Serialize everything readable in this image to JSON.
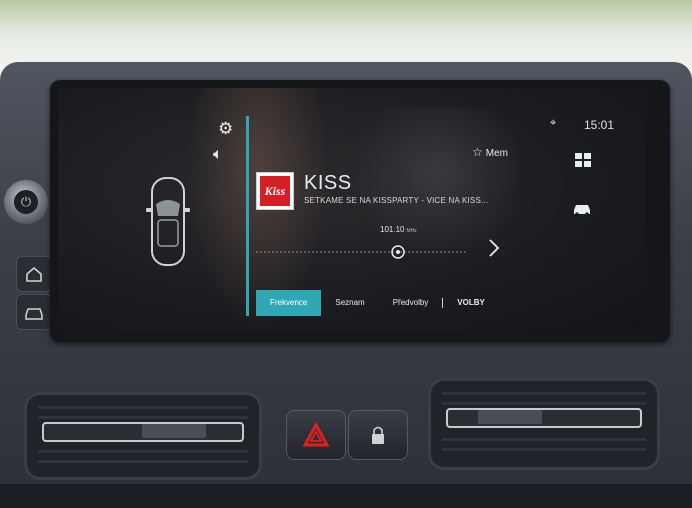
{
  "radio": {
    "station_name": "KISS",
    "logo_text": "Kiss",
    "rds_text": "SETKAME SE NA KISSPARTY - VICE NA KISS...",
    "frequency": "101.10",
    "frequency_unit": "MHz",
    "favorite_label": "Mem"
  },
  "status_bar": {
    "time": "15:01"
  },
  "tabs": [
    {
      "label": "Frekvence",
      "active": true
    },
    {
      "label": "Seznam",
      "active": false
    },
    {
      "label": "Předvolby",
      "active": false
    },
    {
      "label": "VOLBY",
      "active": false
    }
  ],
  "colors": {
    "accent": "#2fa7b4",
    "logo_red": "#d41f26",
    "hazard_red": "#e02020",
    "text": "#e8ecef"
  },
  "icons": [
    "settings-icon",
    "volume-icon",
    "car-icon",
    "star-icon",
    "location-icon",
    "apps-grid-icon",
    "nav-car-icon",
    "next-arrow-icon",
    "power-icon",
    "home-icon",
    "hazard-icon",
    "lock-icon"
  ]
}
